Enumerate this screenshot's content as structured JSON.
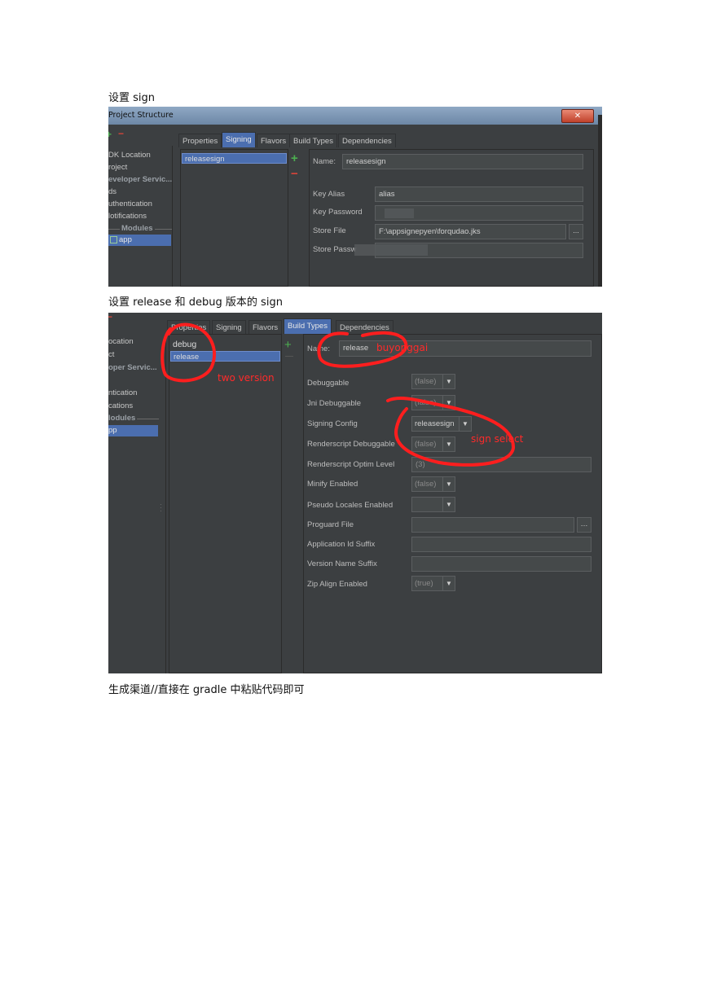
{
  "doc": {
    "heading1": "设置 sign",
    "heading2": "设置 release 和 debug 版本的 sign",
    "heading3": "生成渠道//直接在 gradle 中粘贴代码即可"
  },
  "shot1": {
    "window_title": "Project Structure",
    "close_label": "✕",
    "tabs": [
      "Properties",
      "Signing",
      "Flavors",
      "Build Types",
      "Dependencies"
    ],
    "active_tab": "Signing",
    "nav_items": [
      "DK Location",
      "roject",
      "eveloper Servic...",
      "ds",
      "uthentication",
      "lotifications"
    ],
    "modules_label": "Modules",
    "module_app": "app",
    "list_items": [
      "releasesign"
    ],
    "fields": {
      "name_label": "Name:",
      "name_value": "releasesign",
      "key_alias_label": "Key Alias",
      "key_alias_value": "alias",
      "key_password_label": "Key Password",
      "store_file_label": "Store File",
      "store_file_value": "F:\\appsignepyen\\forqudao.jks",
      "store_password_label": "Store Passw"
    },
    "browse_label": "..."
  },
  "shot2": {
    "tabs": [
      "Properties",
      "Signing",
      "Flavors",
      "Build Types",
      "Dependencies"
    ],
    "active_tab": "Build Types",
    "nav_items": [
      "ocation",
      "ct",
      "oper Servic...",
      "",
      "ntication",
      "cations"
    ],
    "modules_label": "lodules",
    "module_app": "pp",
    "list_items": [
      "debug",
      "release"
    ],
    "name_label": "Name:",
    "name_value": "release",
    "rows": [
      {
        "label": "Debuggable",
        "value": "(false)"
      },
      {
        "label": "Jni Debuggable",
        "value": "(false)"
      },
      {
        "label": "Signing Config",
        "value": "releasesign"
      },
      {
        "label": "Renderscript Debuggable",
        "value": "(false)"
      },
      {
        "label": "Renderscript Optim Level",
        "value": "(3)"
      },
      {
        "label": "Minify Enabled",
        "value": "(false)"
      },
      {
        "label": "Pseudo Locales Enabled",
        "value": ""
      },
      {
        "label": "Proguard File",
        "value": ""
      },
      {
        "label": "Application Id Suffix",
        "value": ""
      },
      {
        "label": "Version Name Suffix",
        "value": ""
      },
      {
        "label": "Zip Align Enabled",
        "value": "(true)"
      }
    ],
    "annotations": {
      "name_note": "buyonggai",
      "list_note": "two version",
      "sign_note": "sign  select"
    },
    "annotation_color": "#ff2a2a"
  }
}
